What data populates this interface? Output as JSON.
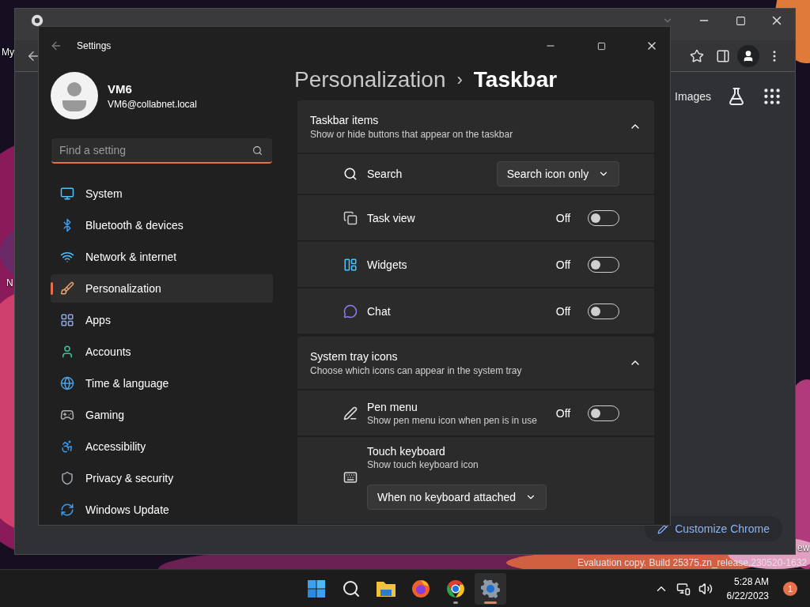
{
  "desktop": {
    "labels": [
      "My",
      "N",
      "ew"
    ],
    "watermark": "Evaluation copy. Build 25375.zn_release.230520-1632"
  },
  "browser": {
    "links": [
      "Images"
    ],
    "customize_button": "Customize Chrome"
  },
  "settings": {
    "title": "Settings",
    "user": {
      "name": "VM6",
      "email": "VM6@collabnet.local"
    },
    "search": {
      "placeholder": "Find a setting"
    },
    "nav": [
      {
        "label": "System",
        "selected": false
      },
      {
        "label": "Bluetooth & devices",
        "selected": false
      },
      {
        "label": "Network & internet",
        "selected": false
      },
      {
        "label": "Personalization",
        "selected": true
      },
      {
        "label": "Apps",
        "selected": false
      },
      {
        "label": "Accounts",
        "selected": false
      },
      {
        "label": "Time & language",
        "selected": false
      },
      {
        "label": "Gaming",
        "selected": false
      },
      {
        "label": "Accessibility",
        "selected": false
      },
      {
        "label": "Privacy & security",
        "selected": false
      },
      {
        "label": "Windows Update",
        "selected": false
      }
    ],
    "breadcrumb": {
      "parent": "Personalization",
      "separator": "›",
      "current": "Taskbar"
    },
    "sections": [
      {
        "title": "Taskbar items",
        "subtitle": "Show or hide buttons that appear on the taskbar",
        "expanded": true,
        "rows": [
          {
            "kind": "dropdown",
            "label": "Search",
            "value": "Search icon only"
          },
          {
            "kind": "toggle",
            "label": "Task view",
            "value": "Off",
            "on": false
          },
          {
            "kind": "toggle",
            "label": "Widgets",
            "value": "Off",
            "on": false
          },
          {
            "kind": "toggle",
            "label": "Chat",
            "value": "Off",
            "on": false
          }
        ]
      },
      {
        "title": "System tray icons",
        "subtitle": "Choose which icons can appear in the system tray",
        "expanded": true,
        "rows": [
          {
            "kind": "toggle",
            "label": "Pen menu",
            "description": "Show pen menu icon when pen is in use",
            "value": "Off",
            "on": false
          },
          {
            "kind": "dropdown_below",
            "label": "Touch keyboard",
            "description": "Show touch keyboard icon",
            "value": "When no keyboard attached"
          }
        ]
      }
    ]
  },
  "taskbar": {
    "apps": [
      {
        "kind": "start",
        "selected": false,
        "running": false
      },
      {
        "kind": "search",
        "selected": false,
        "running": false
      },
      {
        "kind": "files",
        "selected": false,
        "running": false
      },
      {
        "kind": "firefox",
        "selected": false,
        "running": false
      },
      {
        "kind": "chrome",
        "selected": false,
        "running": true
      },
      {
        "kind": "settings",
        "selected": true,
        "running": true
      }
    ],
    "time": "5:28 AM",
    "date": "6/22/2023",
    "badge": "1"
  }
}
